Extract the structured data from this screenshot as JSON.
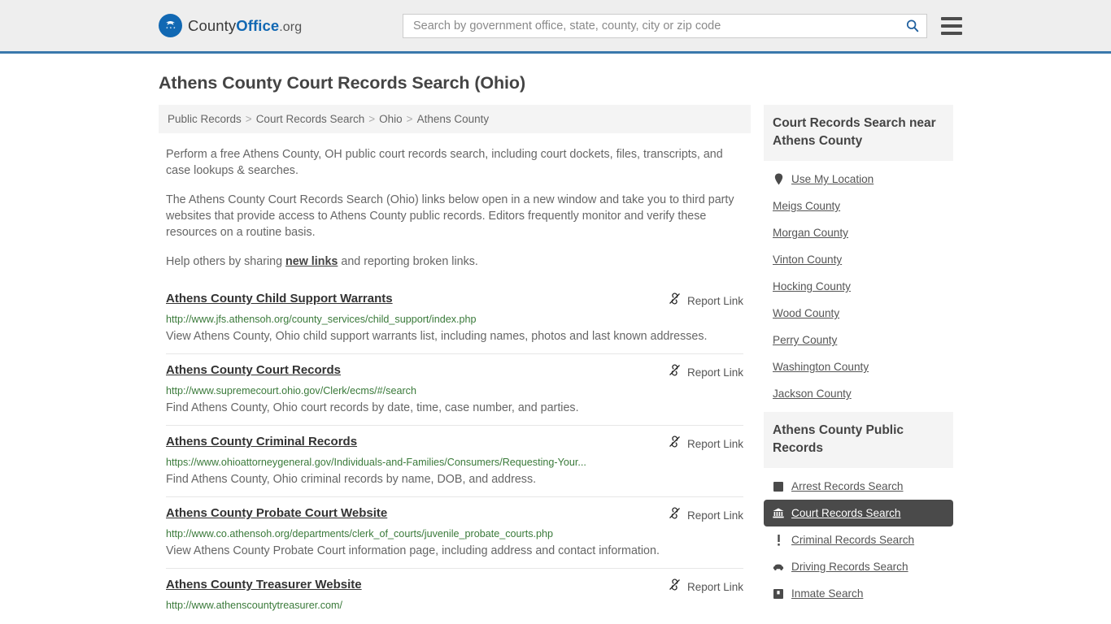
{
  "header": {
    "logo": {
      "part1": "County",
      "part2": "Office",
      "part3": ".org",
      "icon": "eagle-shield-logo"
    },
    "search": {
      "placeholder": "Search by government office, state, county, city or zip code",
      "value": ""
    },
    "search_icon": "search-icon",
    "menu_icon": "hamburger-menu-icon",
    "accent_color": "#3a78ac"
  },
  "page": {
    "title": "Athens County Court Records Search (Ohio)"
  },
  "breadcrumb": {
    "items": [
      "Public Records",
      "Court Records Search",
      "Ohio",
      "Athens County"
    ],
    "separator": ">"
  },
  "intro": {
    "p1": "Perform a free Athens County, OH public court records search, including court dockets, files, transcripts, and case lookups & searches.",
    "p2": "The Athens County Court Records Search (Ohio) links below open in a new window and take you to third party websites that provide access to Athens County public records. Editors frequently monitor and verify these resources on a routine basis.",
    "p3_before": "Help others by sharing ",
    "p3_link": "new links",
    "p3_after": " and reporting broken links."
  },
  "results": {
    "report_label": "Report Link",
    "report_icon": "broken-link-icon",
    "items": [
      {
        "title": "Athens County Child Support Warrants",
        "url": "http://www.jfs.athensoh.org/county_services/child_support/index.php",
        "desc": "View Athens County, Ohio child support warrants list, including names, photos and last known addresses."
      },
      {
        "title": "Athens County Court Records",
        "url": "http://www.supremecourt.ohio.gov/Clerk/ecms/#/search",
        "desc": "Find Athens County, Ohio court records by date, time, case number, and parties."
      },
      {
        "title": "Athens County Criminal Records",
        "url": "https://www.ohioattorneygeneral.gov/Individuals-and-Families/Consumers/Requesting-Your...",
        "desc": "Find Athens County, Ohio criminal records by name, DOB, and address."
      },
      {
        "title": "Athens County Probate Court Website",
        "url": "http://www.co.athensoh.org/departments/clerk_of_courts/juvenile_probate_courts.php",
        "desc": "View Athens County Probate Court information page, including address and contact information."
      },
      {
        "title": "Athens County Treasurer Website",
        "url": "http://www.athenscountytreasurer.com/",
        "desc": ""
      }
    ]
  },
  "sidebar": {
    "nearby": {
      "heading": "Court Records Search near Athens County",
      "use_my_location": {
        "label": "Use My Location",
        "icon": "map-pin-icon"
      },
      "counties": [
        "Meigs County",
        "Morgan County",
        "Vinton County",
        "Hocking County",
        "Wood County",
        "Perry County",
        "Washington County",
        "Jackson County"
      ]
    },
    "public_records": {
      "heading": "Athens County Public Records",
      "items": [
        {
          "label": "Arrest Records Search",
          "icon": "fingerprint-square-icon",
          "active": false
        },
        {
          "label": "Court Records Search",
          "icon": "courthouse-icon",
          "active": true
        },
        {
          "label": "Criminal Records Search",
          "icon": "exclamation-icon",
          "active": false
        },
        {
          "label": "Driving Records Search",
          "icon": "car-icon",
          "active": false
        },
        {
          "label": "Inmate Search",
          "icon": "jail-building-icon",
          "active": false
        }
      ]
    }
  }
}
